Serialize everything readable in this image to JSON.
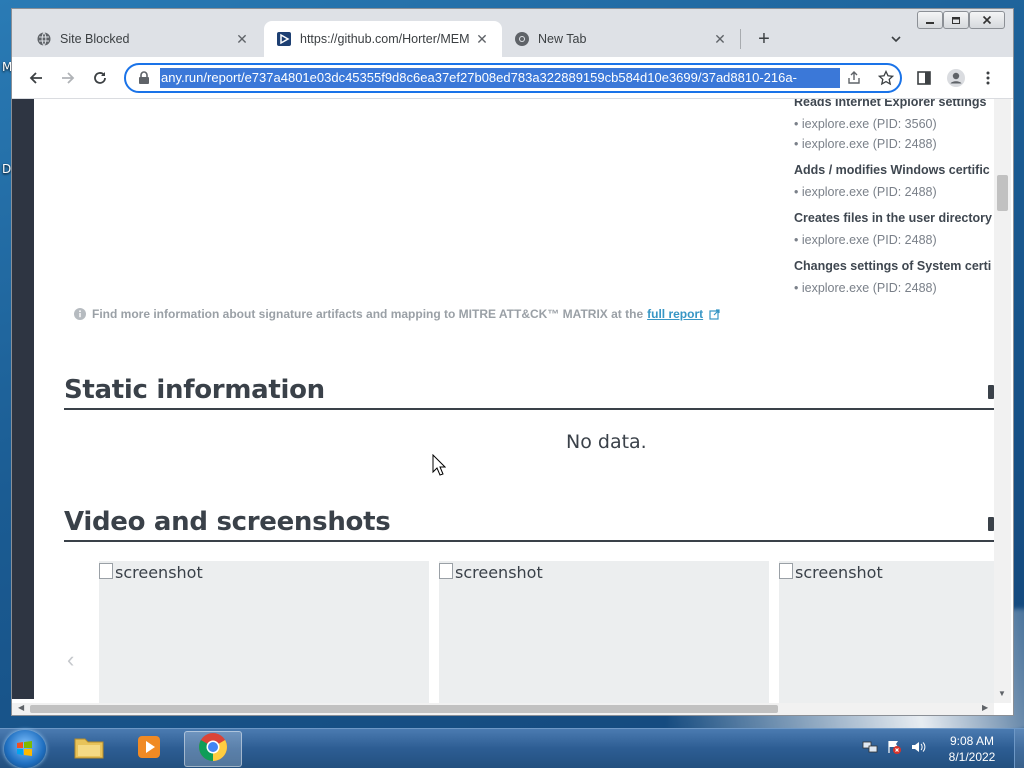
{
  "desktop": {
    "letters": [
      "M",
      "D"
    ]
  },
  "tabs": [
    {
      "title": "Site Blocked",
      "icon": "globe-icon",
      "active": false
    },
    {
      "title": "https://github.com/Horter/MEM",
      "icon": "anyrun-icon",
      "active": true
    },
    {
      "title": "New Tab",
      "icon": "chrome-icon",
      "active": false
    }
  ],
  "toolbar": {
    "url": "any.run/report/e737a4801e03dc45355f9d8c6ea37ef27b08ed783a322889159cb584d10e3699/37ad8810-216a-"
  },
  "right_panel": {
    "items": [
      {
        "type": "heading",
        "text": "Reads Internet Explorer settings"
      },
      {
        "type": "item",
        "text": "• iexplore.exe (PID: 3560)"
      },
      {
        "type": "item",
        "text": "• iexplore.exe (PID: 2488)"
      },
      {
        "type": "heading",
        "text": "Adds / modifies Windows certific"
      },
      {
        "type": "item",
        "text": "• iexplore.exe (PID: 2488)"
      },
      {
        "type": "heading",
        "text": "Creates files in the user directory"
      },
      {
        "type": "item",
        "text": "• iexplore.exe (PID: 2488)"
      },
      {
        "type": "heading",
        "text": "Changes settings of System certi"
      },
      {
        "type": "item",
        "text": "• iexplore.exe (PID: 2488)"
      }
    ]
  },
  "info": {
    "text": "Find more information about signature artifacts and mapping to MITRE ATT&CK™ MATRIX at the",
    "link": "full report"
  },
  "static_section": {
    "title": "Static information",
    "no_data": "No data."
  },
  "video_section": {
    "title": "Video and screenshots",
    "screenshot_alt": "screenshot"
  },
  "taskbar": {
    "time": "9:08 AM",
    "date": "8/1/2022"
  },
  "colors": {
    "accent": "#1a73e8",
    "selection": "#3b78d8",
    "link": "#3796c5"
  }
}
